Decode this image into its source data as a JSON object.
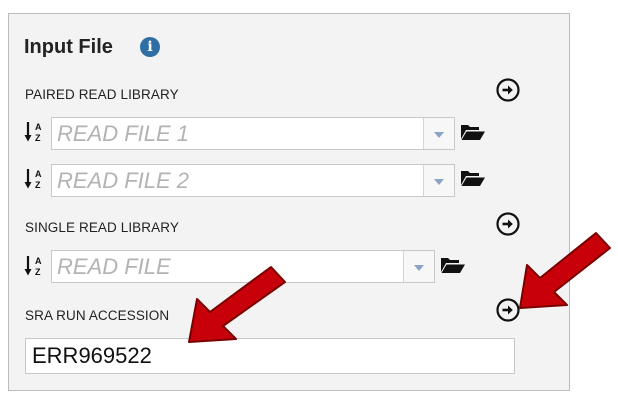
{
  "panel": {
    "title": "Input File",
    "info_icon": "info-icon"
  },
  "paired": {
    "label": "PAIRED READ LIBRARY",
    "file1_placeholder": "READ FILE 1",
    "file2_placeholder": "READ FILE 2"
  },
  "single": {
    "label": "SINGLE READ LIBRARY",
    "file_placeholder": "READ FILE"
  },
  "sra": {
    "label": "SRA RUN ACCESSION",
    "value": "ERR969522"
  },
  "icons": {
    "go": "arrow-circle-right-icon",
    "sort": "sort-alpha-icon",
    "folder": "folder-open-icon",
    "annotation_arrow": "red-arrow"
  },
  "colors": {
    "panel_bg": "#f3f3f3",
    "info_blue": "#2f6fa3",
    "annotation_red": "#c8000a",
    "caret_blue": "#8aa4c6"
  }
}
